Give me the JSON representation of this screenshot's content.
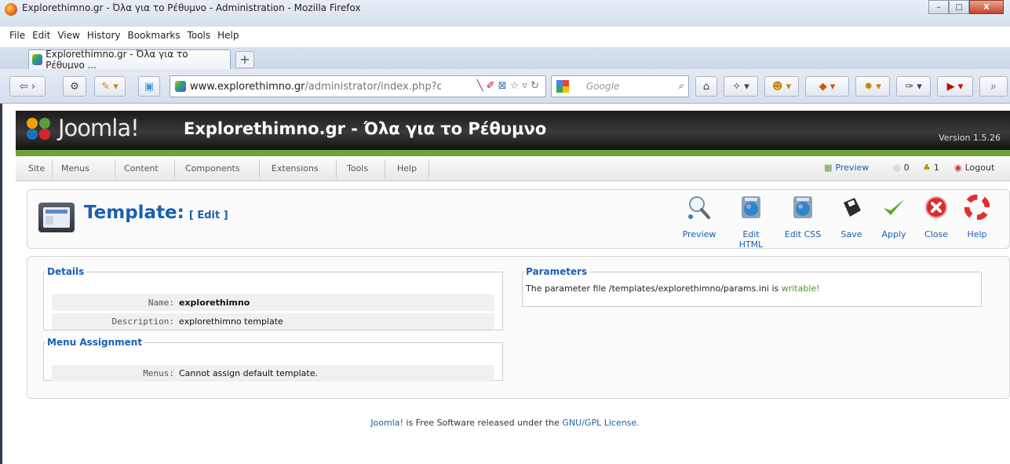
{
  "window": {
    "title": "Explorethimno.gr - Όλα για το Ρέθυμνο - Administration - Mozilla Firefox",
    "buttons": [
      "–",
      "□",
      "X"
    ]
  },
  "menubar": [
    "File",
    "Edit",
    "View",
    "History",
    "Bookmarks",
    "Tools",
    "Help"
  ],
  "tabs": [
    {
      "label": "Explorethimno.gr - Όλα για το Ρέθυμνο ..."
    }
  ],
  "newtab": "+",
  "nav": {
    "url_domain": "www.explorethimno.gr",
    "url_path": "/administrator/index.php?op",
    "search_placeholder": "Google"
  },
  "joomla": {
    "brand": "Joomla!",
    "site_title": "Explorethimno.gr - Όλα για το Ρέθυμνο",
    "version": "Version 1.5.26"
  },
  "admin_menu": [
    "Site",
    "Menus",
    "Content",
    "Components",
    "Extensions",
    "Tools",
    "Help"
  ],
  "status": {
    "preview": "Preview",
    "messages": "0",
    "users": "1",
    "logout": "Logout"
  },
  "page": {
    "title": "Template:",
    "subtitle": "[ Edit ]"
  },
  "toolbar": [
    {
      "label": "Preview",
      "icon": "magnifier-icon"
    },
    {
      "label": "Edit HTML",
      "icon": "globe-html-icon"
    },
    {
      "label": "Edit CSS",
      "icon": "globe-css-icon"
    },
    {
      "label": "Save",
      "icon": "floppy-icon"
    },
    {
      "label": "Apply",
      "icon": "checkmark-icon"
    },
    {
      "label": "Close",
      "icon": "close-circle-icon"
    },
    {
      "label": "Help",
      "icon": "lifebuoy-icon"
    }
  ],
  "details": {
    "legend": "Details",
    "name_label": "Name:",
    "name_value": "explorethimno",
    "desc_label": "Description:",
    "desc_value": "explorethimno template"
  },
  "menu_assignment": {
    "legend": "Menu Assignment",
    "menus_label": "Menus:",
    "menus_value": "Cannot assign default template."
  },
  "parameters": {
    "legend": "Parameters",
    "text": "The parameter file /templates/explorethimno/params.ini is ",
    "status": "writable!"
  },
  "footer": {
    "joomla_link": "Joomla!",
    "middle": " is Free Software released under the ",
    "license_link": "GNU/GPL License."
  },
  "colors": {
    "accent": "#1a5fb4",
    "header_green": "#6fa33a",
    "writable": "#4a9a2a"
  }
}
